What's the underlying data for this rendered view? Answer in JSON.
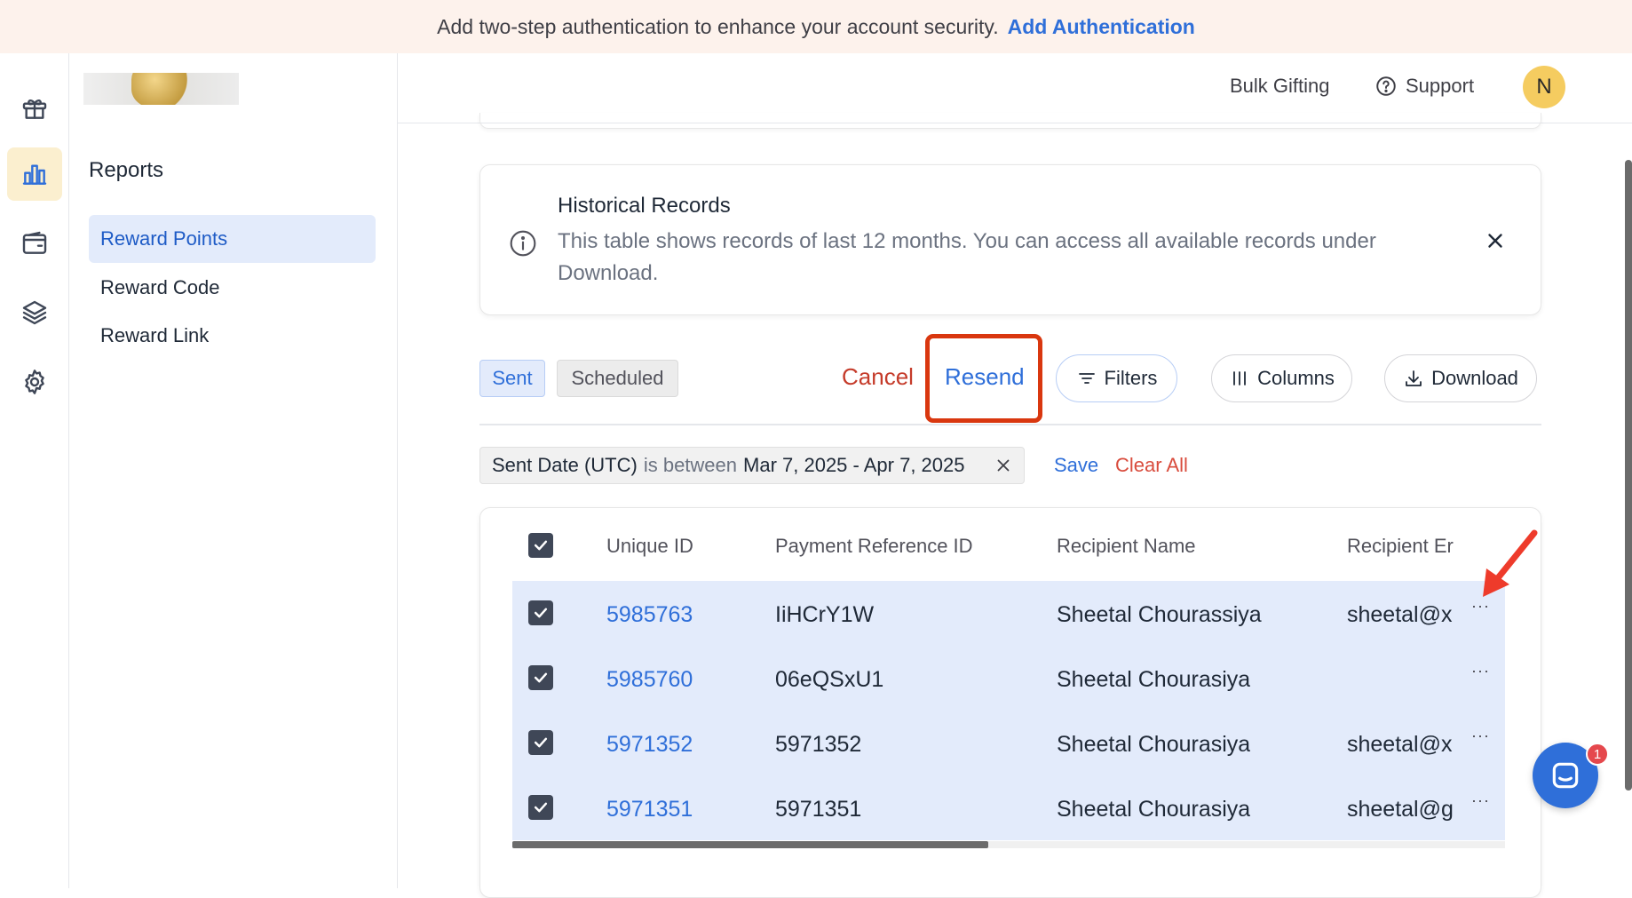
{
  "banner": {
    "text": "Add two-step authentication to enhance your account security.",
    "link": "Add Authentication"
  },
  "rail": {
    "icons": [
      "gift-icon",
      "bar-chart-icon",
      "wallet-icon",
      "layers-icon",
      "gear-icon"
    ],
    "active": "bar-chart-icon"
  },
  "sidebar": {
    "title": "Reports",
    "items": [
      {
        "label": "Reward Points",
        "active": true
      },
      {
        "label": "Reward Code",
        "active": false
      },
      {
        "label": "Reward Link",
        "active": false
      }
    ]
  },
  "header": {
    "bulk_gifting": "Bulk Gifting",
    "support": "Support",
    "avatar_initial": "N"
  },
  "info": {
    "title": "Historical Records",
    "text": "This table shows records of last 12 months. You can access all available records under Download."
  },
  "tabs": {
    "sent": "Sent",
    "scheduled": "Scheduled",
    "active": "sent"
  },
  "actions": {
    "cancel": "Cancel",
    "resend": "Resend",
    "filters": "Filters",
    "columns": "Columns",
    "download": "Download"
  },
  "filter_chip": {
    "field": "Sent Date (UTC)",
    "operator": "is between",
    "value": "Mar 7, 2025 - Apr 7, 2025",
    "save": "Save",
    "clear_all": "Clear All"
  },
  "table": {
    "columns": [
      "Unique ID",
      "Payment Reference ID",
      "Recipient Name",
      "Recipient Er"
    ],
    "rows": [
      {
        "id": "5985763",
        "payment_ref": "IiHCrY1W",
        "name": "Sheetal Chourassiya",
        "email": "sheetal@x"
      },
      {
        "id": "5985760",
        "payment_ref": "06eQSxU1",
        "name": "Sheetal Chourasiya",
        "email": ""
      },
      {
        "id": "5971352",
        "payment_ref": "5971352",
        "name": "Sheetal Chourasiya",
        "email": "sheetal@x"
      },
      {
        "id": "5971351",
        "payment_ref": "5971351",
        "name": "Sheetal Chourasiya",
        "email": "sheetal@g"
      }
    ],
    "row_menu": "···"
  },
  "chat": {
    "badge": "1"
  },
  "colors": {
    "accent": "#2f6fd9",
    "danger": "#c53b2a",
    "highlight_box": "#d9370f",
    "selected_row": "#e3ebfb",
    "banner_bg": "#fdf2ec",
    "avatar": "#f5cc60"
  }
}
